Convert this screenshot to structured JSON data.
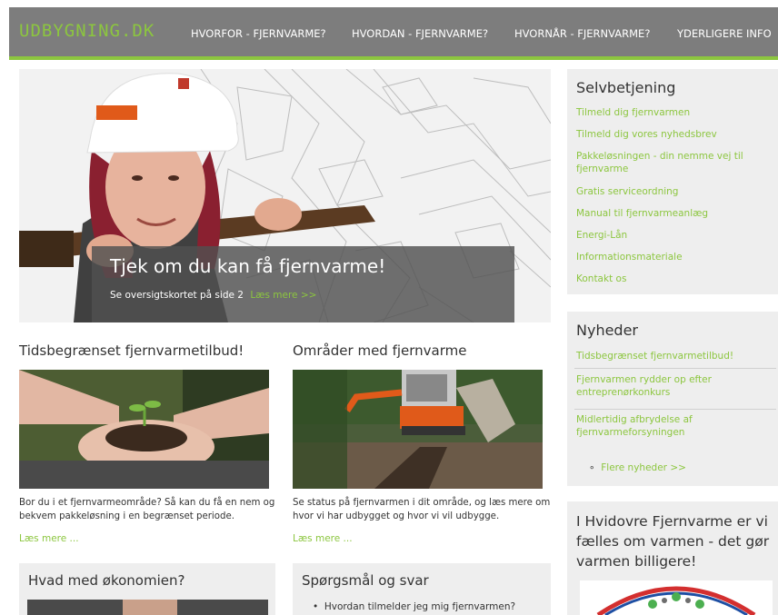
{
  "header": {
    "logo": "UDBYGNING.DK",
    "nav": [
      "HVORFOR - FJERNVARME?",
      "HVORDAN - FJERNVARME?",
      "HVORNÅR - FJERNVARME?",
      "YDERLIGERE INFO"
    ]
  },
  "hero": {
    "title": "Tjek om du kan få fjernvarme!",
    "subtitle": "Se oversigtskortet på side 2",
    "more": "Læs mere >>"
  },
  "articles": [
    {
      "title": "Tidsbegrænset fjernvarmetilbud!",
      "text": "Bor du i et fjernvarmeområde? Så kan du få en nem og bekvem pakkeløsning i en begrænset periode.",
      "more": "Læs mere ..."
    },
    {
      "title": "Områder med fjernvarme",
      "text": "Se status på fjernvarmen i dit område, og læs mere om hvor vi har udbygget og hvor vi vil udbygge.",
      "more": "Læs mere ..."
    }
  ],
  "economy": {
    "title": "Hvad med økonomien?"
  },
  "faq": {
    "title": "Spørgsmål og svar",
    "items": [
      "Hvordan tilmelder jeg mig fjernvarmen?"
    ]
  },
  "sidebar": {
    "selfservice": {
      "title": "Selvbetjening",
      "links": [
        "Tilmeld dig fjernvarmen",
        "Tilmeld dig vores nyhedsbrev",
        "Pakkeløsningen - din nemme vej til fjernvarme",
        "Gratis serviceordning",
        "Manual til fjernvarmeanlæg",
        "Energi-Lån",
        "Informationsmateriale",
        "Kontakt os"
      ]
    },
    "news": {
      "title": "Nyheder",
      "items": [
        "Tidsbegrænset fjernvarmetilbud!",
        "Fjernvarmen rydder op efter entreprenørkonkurs",
        "Midlertidig afbrydelse af fjernvarmeforsyningen"
      ],
      "more": "Flere nyheder >>"
    },
    "slogan": "I Hvidovre Fjernvarme er vi fælles om varmen - det gør varmen billigere!"
  },
  "colors": {
    "accent": "#8cc63f",
    "header_bg": "#7d7d7d",
    "sidebar_bg": "#eeeeee",
    "text": "#333333"
  }
}
